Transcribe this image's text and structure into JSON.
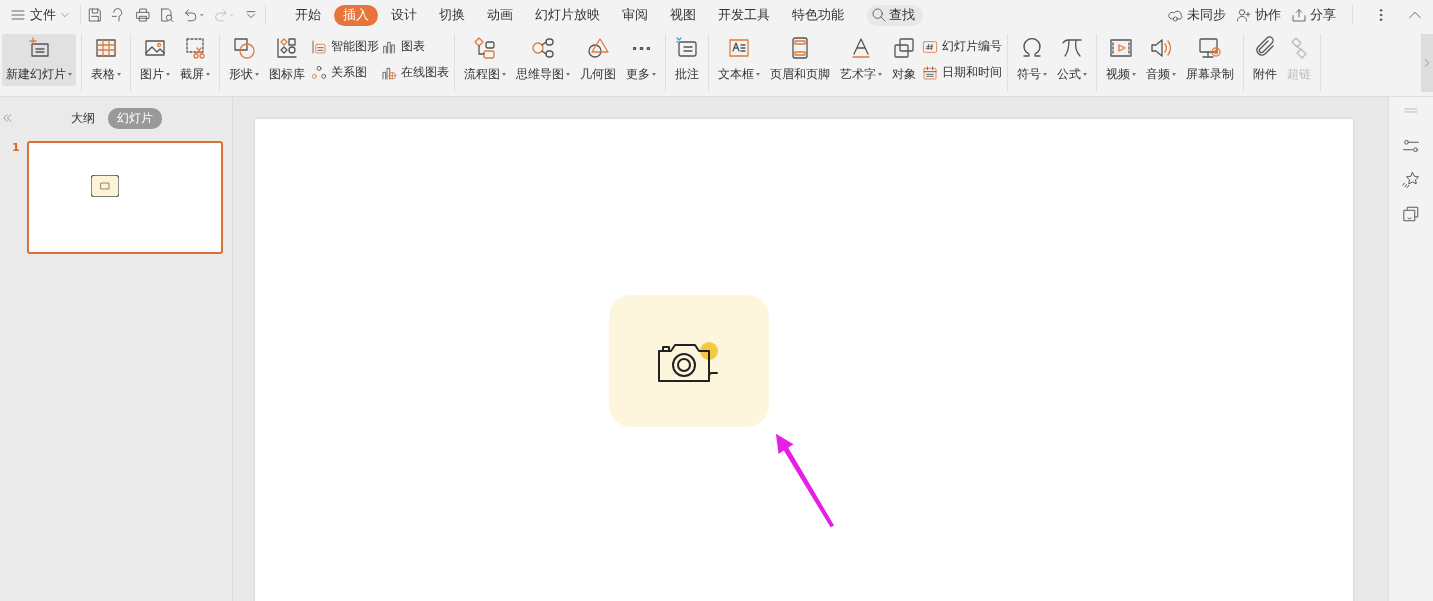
{
  "menu": {
    "label": "文件"
  },
  "tabs": [
    {
      "label": "开始",
      "selected": false
    },
    {
      "label": "插入",
      "selected": true
    },
    {
      "label": "设计",
      "selected": false
    },
    {
      "label": "切换",
      "selected": false
    },
    {
      "label": "动画",
      "selected": false
    },
    {
      "label": "幻灯片放映",
      "selected": false
    },
    {
      "label": "审阅",
      "selected": false
    },
    {
      "label": "视图",
      "selected": false
    },
    {
      "label": "开发工具",
      "selected": false
    },
    {
      "label": "特色功能",
      "selected": false
    }
  ],
  "search": {
    "label": "查找"
  },
  "account_actions": [
    {
      "label": "未同步"
    },
    {
      "label": "协作"
    },
    {
      "label": "分享"
    }
  ],
  "ribbon": {
    "groups": [
      {
        "items": [
          {
            "kind": "large",
            "label": "新建幻灯片",
            "dropdown": true,
            "highlighted": true,
            "disabled": false
          }
        ]
      },
      {
        "items": [
          {
            "kind": "large",
            "label": "表格",
            "dropdown": true,
            "highlighted": false,
            "disabled": false
          }
        ]
      },
      {
        "items": [
          {
            "kind": "large",
            "label": "图片",
            "dropdown": true,
            "highlighted": false,
            "disabled": false
          },
          {
            "kind": "large",
            "label": "截屏",
            "dropdown": true,
            "highlighted": false,
            "disabled": false
          }
        ]
      },
      {
        "items": [
          {
            "kind": "large",
            "label": "形状",
            "dropdown": true,
            "highlighted": false,
            "disabled": false
          },
          {
            "kind": "large",
            "label": "图标库",
            "dropdown": false,
            "highlighted": false,
            "disabled": false
          },
          {
            "kind": "stack",
            "rows": [
              {
                "label": "智能图形"
              },
              {
                "label": "关系图"
              }
            ]
          },
          {
            "kind": "stack",
            "rows": [
              {
                "label": "图表"
              },
              {
                "label": "在线图表"
              }
            ]
          }
        ]
      },
      {
        "items": [
          {
            "kind": "large",
            "label": "流程图",
            "dropdown": true,
            "highlighted": false,
            "disabled": false
          },
          {
            "kind": "large",
            "label": "思维导图",
            "dropdown": true,
            "highlighted": false,
            "disabled": false
          },
          {
            "kind": "large",
            "label": "几何图",
            "dropdown": false,
            "highlighted": false,
            "disabled": false
          },
          {
            "kind": "large",
            "label": "更多",
            "dropdown": true,
            "highlighted": false,
            "disabled": false
          }
        ]
      },
      {
        "items": [
          {
            "kind": "large",
            "label": "批注",
            "dropdown": false,
            "highlighted": false,
            "disabled": false
          }
        ]
      },
      {
        "items": [
          {
            "kind": "large",
            "label": "文本框",
            "dropdown": true,
            "highlighted": false,
            "disabled": false
          },
          {
            "kind": "large",
            "label": "页眉和页脚",
            "dropdown": false,
            "highlighted": false,
            "disabled": false
          },
          {
            "kind": "large",
            "label": "艺术字",
            "dropdown": true,
            "highlighted": false,
            "disabled": false
          },
          {
            "kind": "large",
            "label": "对象",
            "dropdown": false,
            "highlighted": false,
            "disabled": false
          },
          {
            "kind": "stack",
            "rows": [
              {
                "label": "幻灯片编号"
              },
              {
                "label": "日期和时间"
              }
            ]
          }
        ]
      },
      {
        "items": [
          {
            "kind": "large",
            "label": "符号",
            "dropdown": true,
            "highlighted": false,
            "disabled": false
          },
          {
            "kind": "large",
            "label": "公式",
            "dropdown": true,
            "highlighted": false,
            "disabled": false
          }
        ]
      },
      {
        "items": [
          {
            "kind": "large",
            "label": "视频",
            "dropdown": true,
            "highlighted": false,
            "disabled": false
          },
          {
            "kind": "large",
            "label": "音频",
            "dropdown": true,
            "highlighted": false,
            "disabled": false
          },
          {
            "kind": "large",
            "label": "屏幕录制",
            "dropdown": false,
            "highlighted": false,
            "disabled": false
          }
        ]
      },
      {
        "items": [
          {
            "kind": "large",
            "label": "附件",
            "dropdown": false,
            "highlighted": false,
            "disabled": false
          },
          {
            "kind": "large",
            "label": "超链",
            "dropdown": false,
            "highlighted": false,
            "disabled": true
          }
        ]
      }
    ]
  },
  "panel": {
    "tabs": [
      {
        "label": "大纲",
        "selected": false
      },
      {
        "label": "幻灯片",
        "selected": true
      }
    ]
  },
  "slides": [
    {
      "number": "1",
      "selected": true
    }
  ]
}
